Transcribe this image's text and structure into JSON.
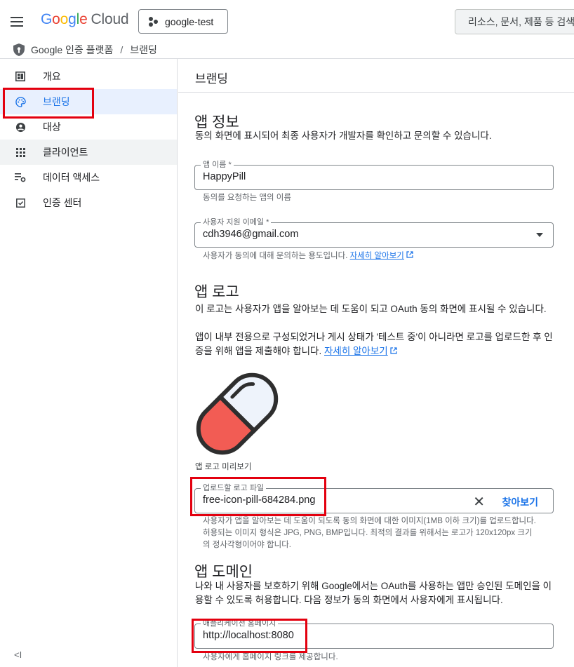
{
  "header": {
    "logo_parts": [
      "G",
      "o",
      "o",
      "g",
      "l",
      "e"
    ],
    "logo_suffix": "Cloud",
    "project": "google-test",
    "search_placeholder": "리소스, 문서, 제품 등 검색(/)"
  },
  "breadcrumb": {
    "root": "Google 인증 플랫폼",
    "separator": "/",
    "current": "브랜딩"
  },
  "sidebar": {
    "items": [
      {
        "label": "개요",
        "icon": "dashboard-icon"
      },
      {
        "label": "브랜딩",
        "icon": "palette-icon",
        "active": true
      },
      {
        "label": "대상",
        "icon": "person-icon"
      },
      {
        "label": "클라이언트",
        "icon": "apps-grid-icon"
      },
      {
        "label": "데이터 액세스",
        "icon": "data-settings-icon"
      },
      {
        "label": "인증 센터",
        "icon": "verified-checkbox-icon"
      }
    ],
    "collapse_label": "<I"
  },
  "main": {
    "title": "브랜딩",
    "app_info": {
      "heading": "앱 정보",
      "description": "동의 화면에 표시되어 최종 사용자가 개발자를 확인하고 문의할 수 있습니다.",
      "app_name_label": "앱 이름 *",
      "app_name_value": "HappyPill",
      "app_name_hint": "동의를 요청하는 앱의 이름",
      "support_email_label": "사용자 지원 이메일 *",
      "support_email_value": "cdh3946@gmail.com",
      "support_email_hint": "사용자가 동의에 대해 문의하는 용도입니다.",
      "learn_more": "자세히 알아보기"
    },
    "app_logo": {
      "heading": "앱 로고",
      "description_1": "이 로고는 사용자가 앱을 알아보는 데 도움이 되고 OAuth 동의 화면에 표시될 수 있습니다.",
      "description_2": "앱이 내부 전용으로 구성되었거나 게시 상태가 '테스트 중'이 아니라면 로고를 업로드한 후 인증을 위해 앱을 제출해야 합니다.",
      "learn_more": "자세히 알아보기",
      "preview_label": "앱 로고 미리보기",
      "upload_label": "업로드할 로고 파일",
      "upload_value": "free-icon-pill-684284.png",
      "browse_label": "찾아보기",
      "upload_hint": "사용자가 앱을 알아보는 데 도움이 되도록 동의 화면에 대한 이미지(1MB 이하 크기)를 업로드합니다. 허용되는 이미지 형식은 JPG, PNG, BMP입니다. 최적의 결과를 위해서는 로고가 120x120px 크기의 정사각형이어야 합니다."
    },
    "app_domain": {
      "heading": "앱 도메인",
      "description": "나와 내 사용자를 보호하기 위해 Google에서는 OAuth를 사용하는 앱만 승인된 도메인을 이용할 수 있도록 허용합니다. 다음 정보가 동의 화면에서 사용자에게 표시됩니다.",
      "homepage_label": "애플리케이션 홈페이지",
      "homepage_value": "http://localhost:8080",
      "homepage_hint": "사용자에게 홈페이지 링크를 제공합니다."
    }
  },
  "colors": {
    "accent": "#1a73e8",
    "active_bg": "#e8f0fe",
    "highlight": "#e3000f",
    "pill_red": "#f25c54",
    "pill_white": "#eef3fb",
    "outline": "#2e2e2e"
  }
}
